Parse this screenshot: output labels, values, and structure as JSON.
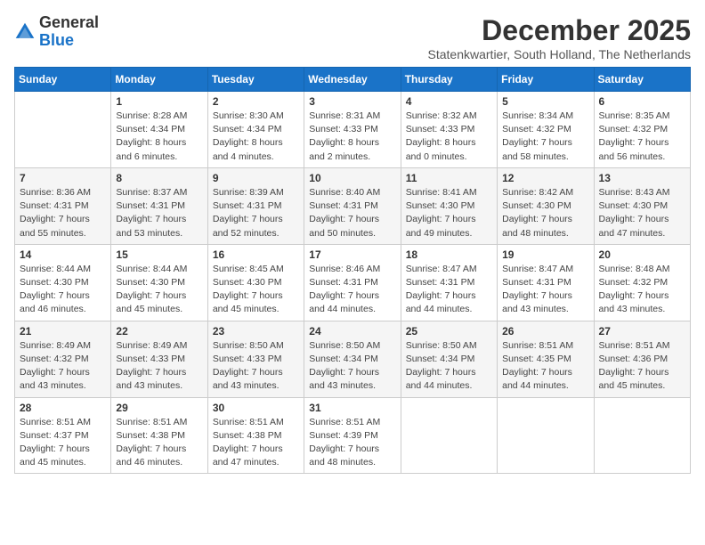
{
  "logo": {
    "general": "General",
    "blue": "Blue"
  },
  "title": "December 2025",
  "subtitle": "Statenkwartier, South Holland, The Netherlands",
  "days_of_week": [
    "Sunday",
    "Monday",
    "Tuesday",
    "Wednesday",
    "Thursday",
    "Friday",
    "Saturday"
  ],
  "weeks": [
    [
      {
        "day": "",
        "info": ""
      },
      {
        "day": "1",
        "info": "Sunrise: 8:28 AM\nSunset: 4:34 PM\nDaylight: 8 hours\nand 6 minutes."
      },
      {
        "day": "2",
        "info": "Sunrise: 8:30 AM\nSunset: 4:34 PM\nDaylight: 8 hours\nand 4 minutes."
      },
      {
        "day": "3",
        "info": "Sunrise: 8:31 AM\nSunset: 4:33 PM\nDaylight: 8 hours\nand 2 minutes."
      },
      {
        "day": "4",
        "info": "Sunrise: 8:32 AM\nSunset: 4:33 PM\nDaylight: 8 hours\nand 0 minutes."
      },
      {
        "day": "5",
        "info": "Sunrise: 8:34 AM\nSunset: 4:32 PM\nDaylight: 7 hours\nand 58 minutes."
      },
      {
        "day": "6",
        "info": "Sunrise: 8:35 AM\nSunset: 4:32 PM\nDaylight: 7 hours\nand 56 minutes."
      }
    ],
    [
      {
        "day": "7",
        "info": "Sunrise: 8:36 AM\nSunset: 4:31 PM\nDaylight: 7 hours\nand 55 minutes."
      },
      {
        "day": "8",
        "info": "Sunrise: 8:37 AM\nSunset: 4:31 PM\nDaylight: 7 hours\nand 53 minutes."
      },
      {
        "day": "9",
        "info": "Sunrise: 8:39 AM\nSunset: 4:31 PM\nDaylight: 7 hours\nand 52 minutes."
      },
      {
        "day": "10",
        "info": "Sunrise: 8:40 AM\nSunset: 4:31 PM\nDaylight: 7 hours\nand 50 minutes."
      },
      {
        "day": "11",
        "info": "Sunrise: 8:41 AM\nSunset: 4:30 PM\nDaylight: 7 hours\nand 49 minutes."
      },
      {
        "day": "12",
        "info": "Sunrise: 8:42 AM\nSunset: 4:30 PM\nDaylight: 7 hours\nand 48 minutes."
      },
      {
        "day": "13",
        "info": "Sunrise: 8:43 AM\nSunset: 4:30 PM\nDaylight: 7 hours\nand 47 minutes."
      }
    ],
    [
      {
        "day": "14",
        "info": "Sunrise: 8:44 AM\nSunset: 4:30 PM\nDaylight: 7 hours\nand 46 minutes."
      },
      {
        "day": "15",
        "info": "Sunrise: 8:44 AM\nSunset: 4:30 PM\nDaylight: 7 hours\nand 45 minutes."
      },
      {
        "day": "16",
        "info": "Sunrise: 8:45 AM\nSunset: 4:30 PM\nDaylight: 7 hours\nand 45 minutes."
      },
      {
        "day": "17",
        "info": "Sunrise: 8:46 AM\nSunset: 4:31 PM\nDaylight: 7 hours\nand 44 minutes."
      },
      {
        "day": "18",
        "info": "Sunrise: 8:47 AM\nSunset: 4:31 PM\nDaylight: 7 hours\nand 44 minutes."
      },
      {
        "day": "19",
        "info": "Sunrise: 8:47 AM\nSunset: 4:31 PM\nDaylight: 7 hours\nand 43 minutes."
      },
      {
        "day": "20",
        "info": "Sunrise: 8:48 AM\nSunset: 4:32 PM\nDaylight: 7 hours\nand 43 minutes."
      }
    ],
    [
      {
        "day": "21",
        "info": "Sunrise: 8:49 AM\nSunset: 4:32 PM\nDaylight: 7 hours\nand 43 minutes."
      },
      {
        "day": "22",
        "info": "Sunrise: 8:49 AM\nSunset: 4:33 PM\nDaylight: 7 hours\nand 43 minutes."
      },
      {
        "day": "23",
        "info": "Sunrise: 8:50 AM\nSunset: 4:33 PM\nDaylight: 7 hours\nand 43 minutes."
      },
      {
        "day": "24",
        "info": "Sunrise: 8:50 AM\nSunset: 4:34 PM\nDaylight: 7 hours\nand 43 minutes."
      },
      {
        "day": "25",
        "info": "Sunrise: 8:50 AM\nSunset: 4:34 PM\nDaylight: 7 hours\nand 44 minutes."
      },
      {
        "day": "26",
        "info": "Sunrise: 8:51 AM\nSunset: 4:35 PM\nDaylight: 7 hours\nand 44 minutes."
      },
      {
        "day": "27",
        "info": "Sunrise: 8:51 AM\nSunset: 4:36 PM\nDaylight: 7 hours\nand 45 minutes."
      }
    ],
    [
      {
        "day": "28",
        "info": "Sunrise: 8:51 AM\nSunset: 4:37 PM\nDaylight: 7 hours\nand 45 minutes."
      },
      {
        "day": "29",
        "info": "Sunrise: 8:51 AM\nSunset: 4:38 PM\nDaylight: 7 hours\nand 46 minutes."
      },
      {
        "day": "30",
        "info": "Sunrise: 8:51 AM\nSunset: 4:38 PM\nDaylight: 7 hours\nand 47 minutes."
      },
      {
        "day": "31",
        "info": "Sunrise: 8:51 AM\nSunset: 4:39 PM\nDaylight: 7 hours\nand 48 minutes."
      },
      {
        "day": "",
        "info": ""
      },
      {
        "day": "",
        "info": ""
      },
      {
        "day": "",
        "info": ""
      }
    ]
  ]
}
